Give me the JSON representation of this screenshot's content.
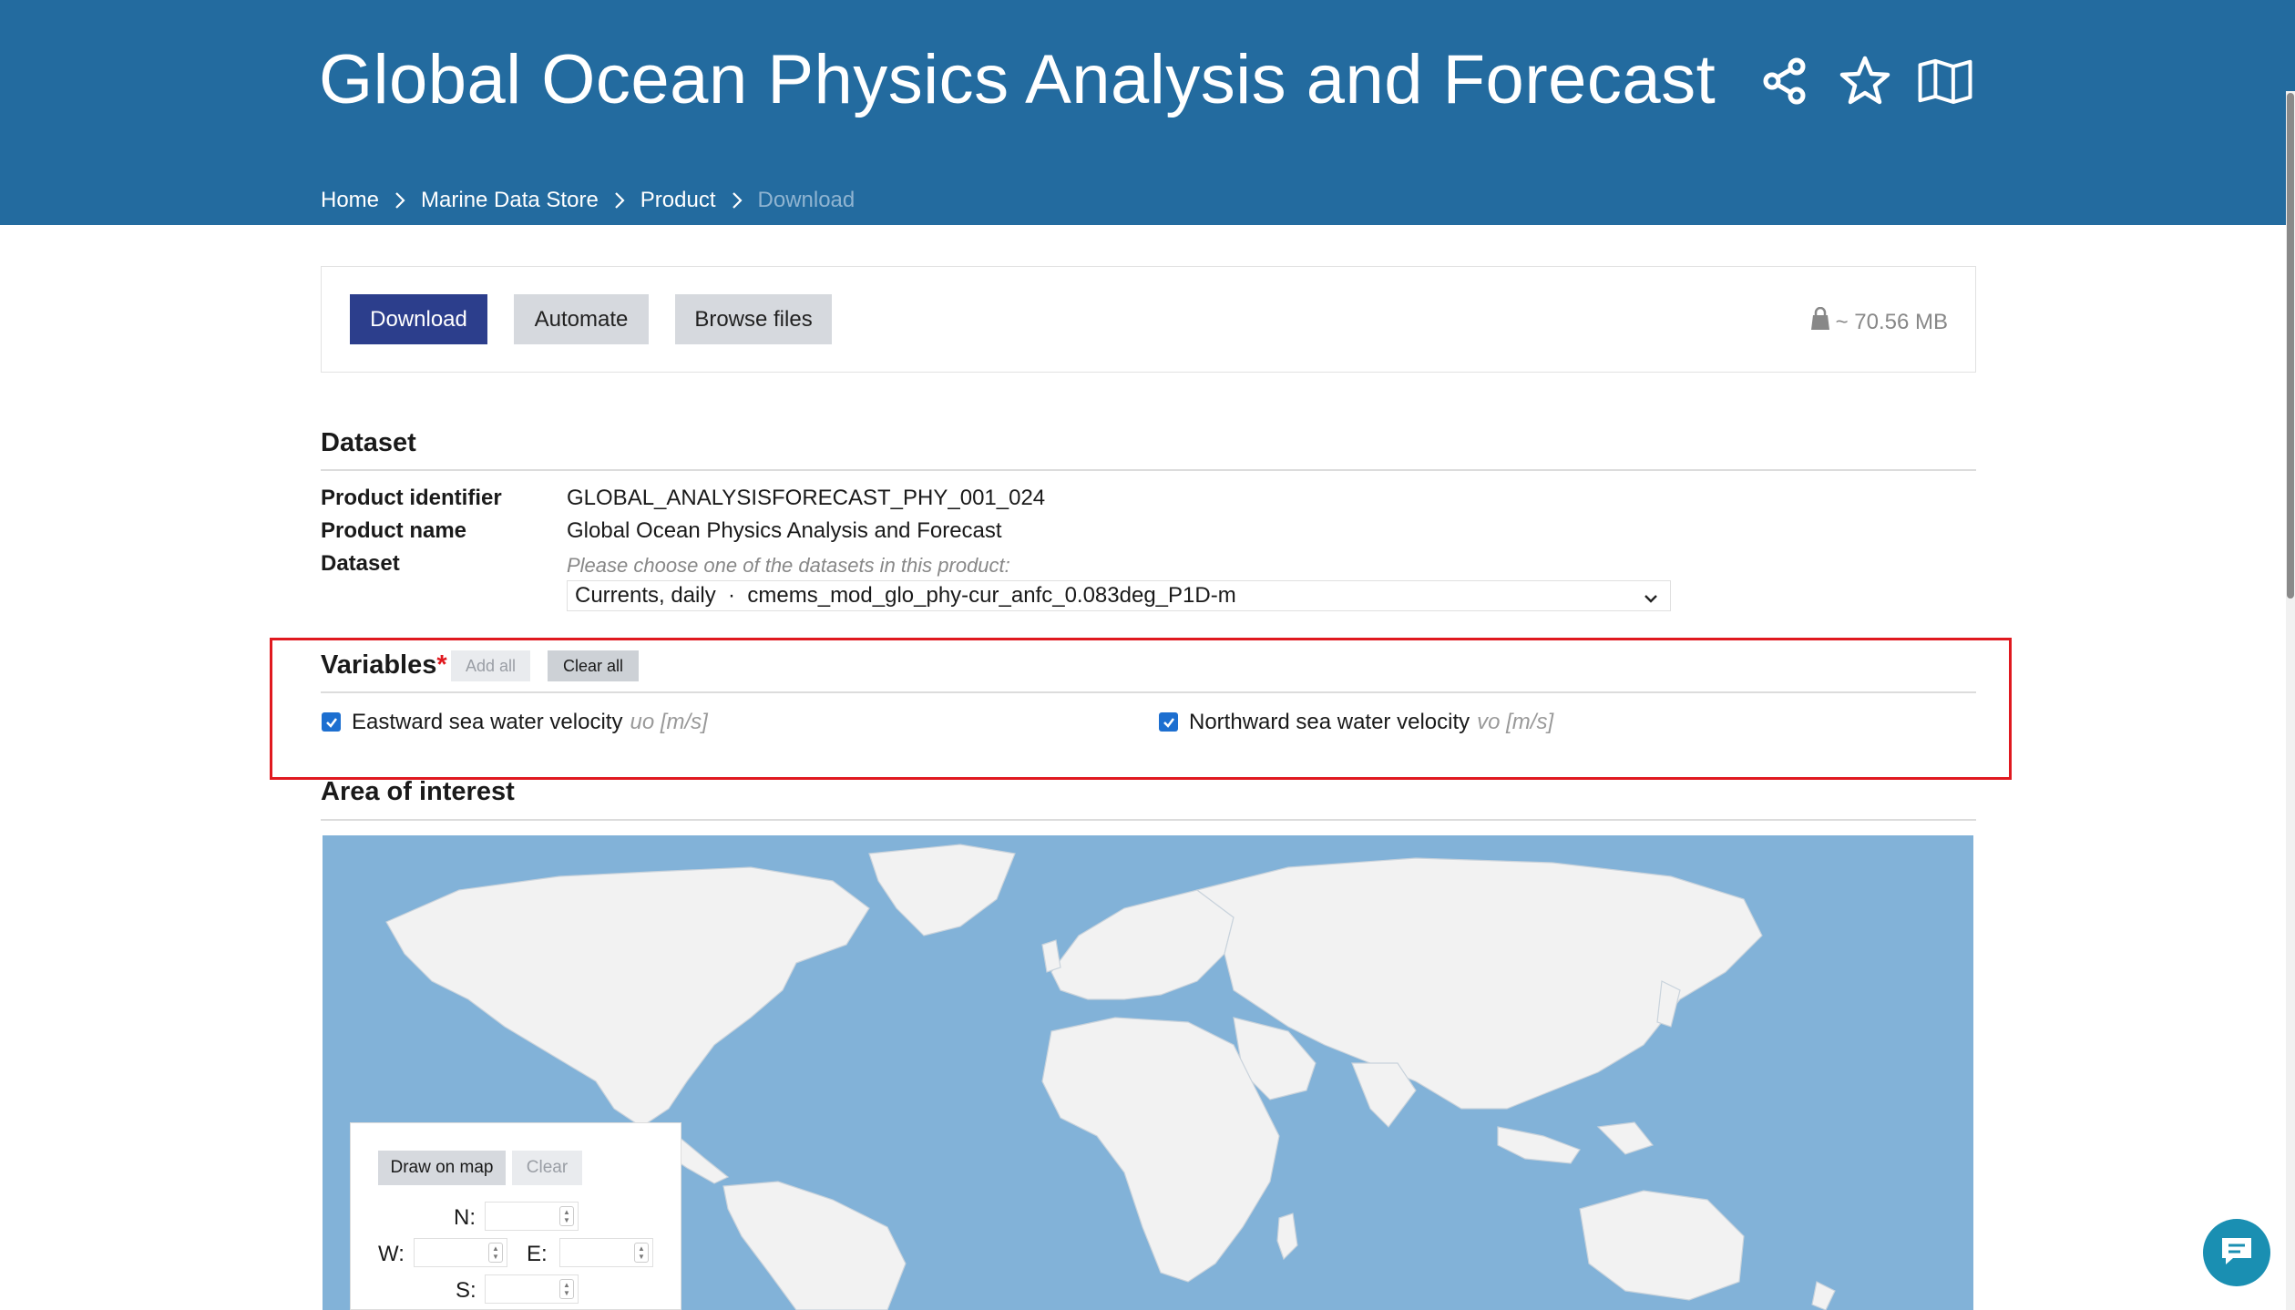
{
  "header": {
    "title": "Global Ocean Physics Analysis and Forecast",
    "icons": [
      "share-icon",
      "star-icon",
      "map-icon"
    ],
    "breadcrumb": [
      "Home",
      "Marine Data Store",
      "Product",
      "Download"
    ]
  },
  "actions": {
    "download_label": "Download",
    "automate_label": "Automate",
    "browse_label": "Browse files",
    "size": "~ 70.56 MB"
  },
  "dataset": {
    "section_title": "Dataset",
    "product_identifier_label": "Product identifier",
    "product_identifier": "GLOBAL_ANALYSISFORECAST_PHY_001_024",
    "product_name_label": "Product name",
    "product_name": "Global Ocean Physics Analysis and Forecast",
    "dataset_label": "Dataset",
    "hint": "Please choose one of the datasets in this product:",
    "selected": "Currents, daily  ·  cmems_mod_glo_phy-cur_anfc_0.083deg_P1D-m"
  },
  "variables": {
    "title": "Variables",
    "required_mark": "*",
    "add_all": "Add all",
    "clear_all": "Clear all",
    "items": [
      {
        "label": "Eastward sea water velocity",
        "meta": "uo [m/s]",
        "checked": true
      },
      {
        "label": "Northward sea water velocity",
        "meta": "vo [m/s]",
        "checked": true
      }
    ]
  },
  "area": {
    "title": "Area of interest",
    "draw_label": "Draw on map",
    "clear_label": "Clear",
    "n_label": "N:",
    "w_label": "W:",
    "e_label": "E:",
    "s_label": "S:"
  },
  "colors": {
    "header_bg": "#236b9f",
    "primary_button": "#2c3e8c",
    "map_water": "#82b2d8",
    "map_land": "#f2f2f2",
    "highlight": "#e0191f",
    "chat": "#1a8fb2"
  }
}
